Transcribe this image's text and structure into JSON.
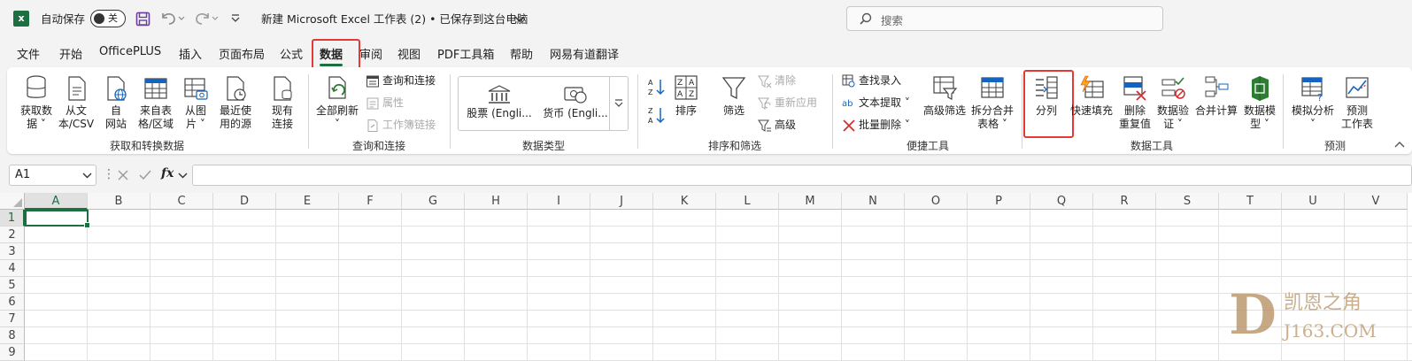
{
  "titlebar": {
    "autosave_label": "自动保存",
    "toggle_state": "关",
    "title": "新建 Microsoft Excel 工作表 (2) • 已保存到这台电脑",
    "search_placeholder": "搜索"
  },
  "menu_tabs": [
    "文件",
    "开始",
    "OfficePLUS",
    "插入",
    "页面布局",
    "公式",
    "数据",
    "审阅",
    "视图",
    "PDF工具箱",
    "帮助",
    "网易有道翻译"
  ],
  "active_tab": "数据",
  "ribbon": {
    "get_transform": {
      "label": "获取和转换数据",
      "buttons": [
        {
          "line1": "获取数",
          "line2": "据 ˅"
        },
        {
          "line1": "从文",
          "line2": "本/CSV"
        },
        {
          "line1": "自",
          "line2": "网站"
        },
        {
          "line1": "来自表",
          "line2": "格/区域"
        },
        {
          "line1": "从图",
          "line2": "片 ˅"
        },
        {
          "line1": "最近使",
          "line2": "用的源"
        },
        {
          "line1": "现有",
          "line2": "连接"
        }
      ]
    },
    "queries": {
      "label": "查询和连接",
      "refresh_line1": "全部刷新",
      "refresh_line2": "˅",
      "items": [
        "查询和连接",
        "属性",
        "工作簿链接"
      ]
    },
    "data_types": {
      "label": "数据类型",
      "stocks": "股票 (Engli...",
      "currency": "货币 (Engli..."
    },
    "sort_filter": {
      "label": "排序和筛选",
      "sort": "排序",
      "filter": "筛选",
      "items": [
        "清除",
        "重新应用",
        "高级"
      ]
    },
    "quick_tools": {
      "label": "便捷工具",
      "items": [
        "查找录入",
        "文本提取 ˅",
        "批量删除 ˅"
      ],
      "advanced_filter": "高级筛选",
      "split_merge_line1": "拆分合并",
      "split_merge_line2": "表格 ˅"
    },
    "data_tools": {
      "label": "数据工具",
      "text_to_columns": "分列",
      "flash_fill": "快速填充",
      "remove_dup_line1": "删除",
      "remove_dup_line2": "重复值",
      "validation_line1": "数据验",
      "validation_line2": "证 ˅",
      "consolidate": "合并计算",
      "model_line1": "数据模",
      "model_line2": "型 ˅"
    },
    "forecast": {
      "label": "预测",
      "whatif_line1": "模拟分析",
      "whatif_line2": "˅",
      "forecast_line1": "预测",
      "forecast_line2": "工作表"
    }
  },
  "formula_bar": {
    "name_box": "A1",
    "fx": "fx",
    "formula": ""
  },
  "columns": [
    "A",
    "B",
    "C",
    "D",
    "E",
    "F",
    "G",
    "H",
    "I",
    "J",
    "K",
    "L",
    "M",
    "N",
    "O",
    "P",
    "Q",
    "R",
    "S",
    "T",
    "U",
    "V"
  ],
  "rows": [
    "1",
    "2",
    "3",
    "4",
    "5",
    "6",
    "7",
    "8",
    "9"
  ],
  "selected_cell": "A1",
  "watermark": {
    "logo_letter": "D",
    "title": "凯恩之角",
    "site": "J163.COM"
  },
  "colors": {
    "accent": "#1d6f42",
    "highlight": "#e53935"
  }
}
